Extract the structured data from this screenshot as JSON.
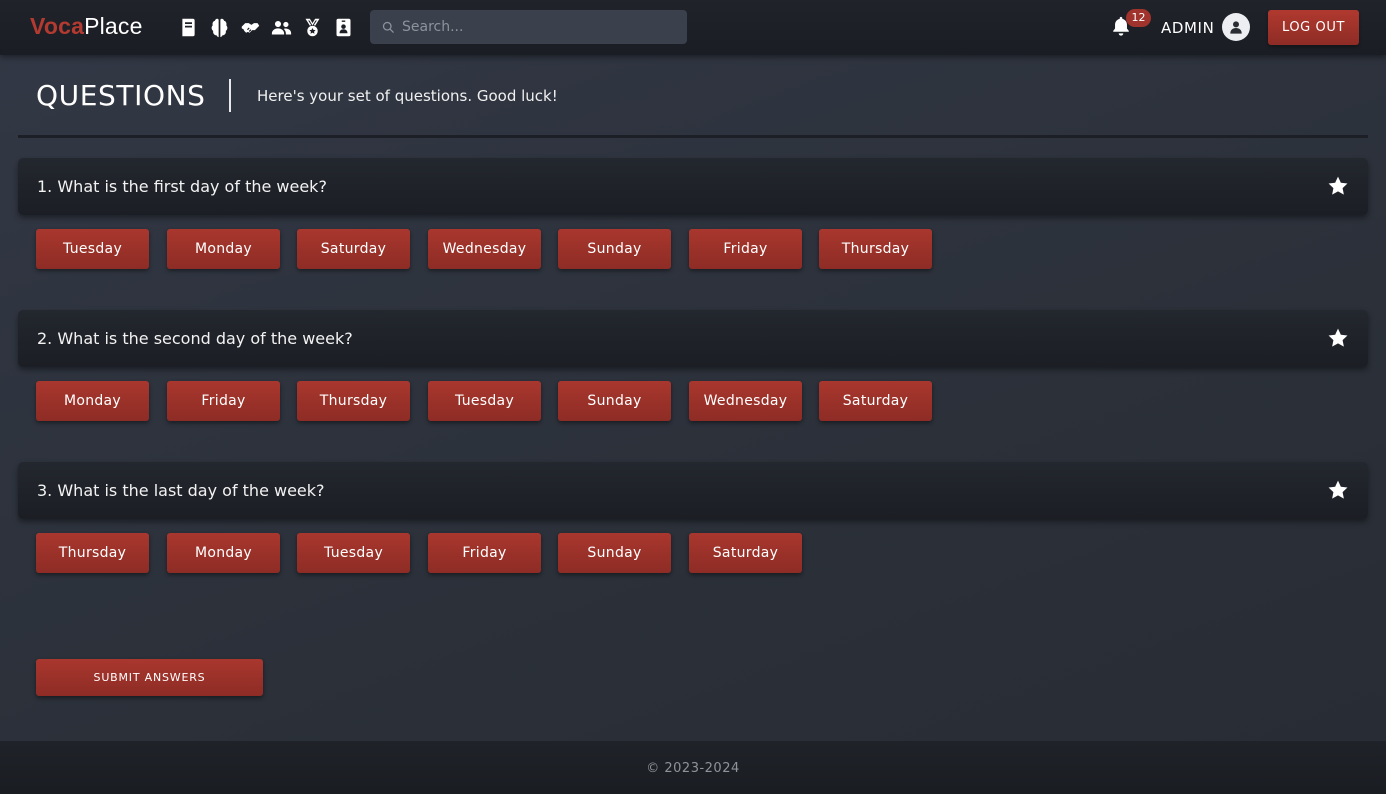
{
  "nav": {
    "logo_part1": "Voca",
    "logo_part2": "Place",
    "icons": [
      "book-icon",
      "brain-icon",
      "handshake-icon",
      "users-icon",
      "medal-icon",
      "id-badge-icon"
    ],
    "search_placeholder": "Search...",
    "notification_count": "12",
    "user_name": "ADMIN",
    "logout_label": "LOG OUT"
  },
  "header": {
    "title": "QUESTIONS",
    "subtitle": "Here's your set of questions. Good luck!"
  },
  "questions": [
    {
      "text": "1. What is the first day of the week?",
      "answers": [
        "Tuesday",
        "Monday",
        "Saturday",
        "Wednesday",
        "Sunday",
        "Friday",
        "Thursday"
      ]
    },
    {
      "text": "2. What is the second day of the week?",
      "answers": [
        "Monday",
        "Friday",
        "Thursday",
        "Tuesday",
        "Sunday",
        "Wednesday",
        "Saturday"
      ]
    },
    {
      "text": "3. What is the last day of the week?",
      "answers": [
        "Thursday",
        "Monday",
        "Tuesday",
        "Friday",
        "Sunday",
        "Saturday"
      ]
    }
  ],
  "submit_label": "SUBMIT ANSWERS",
  "footer": {
    "copyright": "© 2023-2024"
  },
  "colors": {
    "accent": "#a0332b",
    "background": "#2b3039",
    "navbar": "#1c1f25"
  }
}
